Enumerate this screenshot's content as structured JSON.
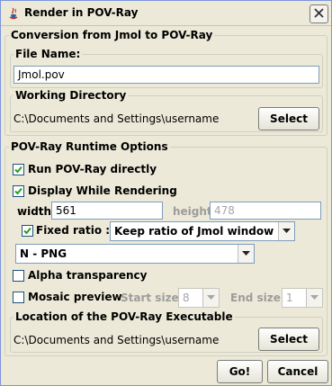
{
  "window": {
    "title": "Render in POV-Ray"
  },
  "conversion": {
    "legend": "Conversion from Jmol to POV-Ray",
    "file_name_legend": "File Name:",
    "file_name_value": "Jmol.pov",
    "working_dir_legend": "Working Directory",
    "working_dir_path": "C:\\Documents and Settings\\username",
    "select_label": "Select"
  },
  "runtime": {
    "legend": "POV-Ray Runtime Options",
    "run_directly_label": "Run POV-Ray directly",
    "run_directly_checked": true,
    "display_rendering_label": "Display While Rendering",
    "display_rendering_checked": true,
    "width_label": "width:",
    "width_value": "561",
    "height_label": "height:",
    "height_value": "478",
    "fixed_ratio_label": "Fixed ratio :",
    "fixed_ratio_checked": true,
    "ratio_option": "Keep ratio of Jmol window",
    "format_option": "N - PNG",
    "alpha_label": "Alpha transparency",
    "alpha_checked": false,
    "mosaic_label": "Mosaic preview",
    "mosaic_checked": false,
    "start_size_label": "Start size :",
    "start_size_value": "8",
    "end_size_label": "End size :",
    "end_size_value": "1",
    "executable_legend": "Location of the POV-Ray Executable",
    "executable_path": "C:\\Documents and Settings\\username",
    "select_label": "Select"
  },
  "footer": {
    "go_label": "Go!",
    "cancel_label": "Cancel"
  }
}
